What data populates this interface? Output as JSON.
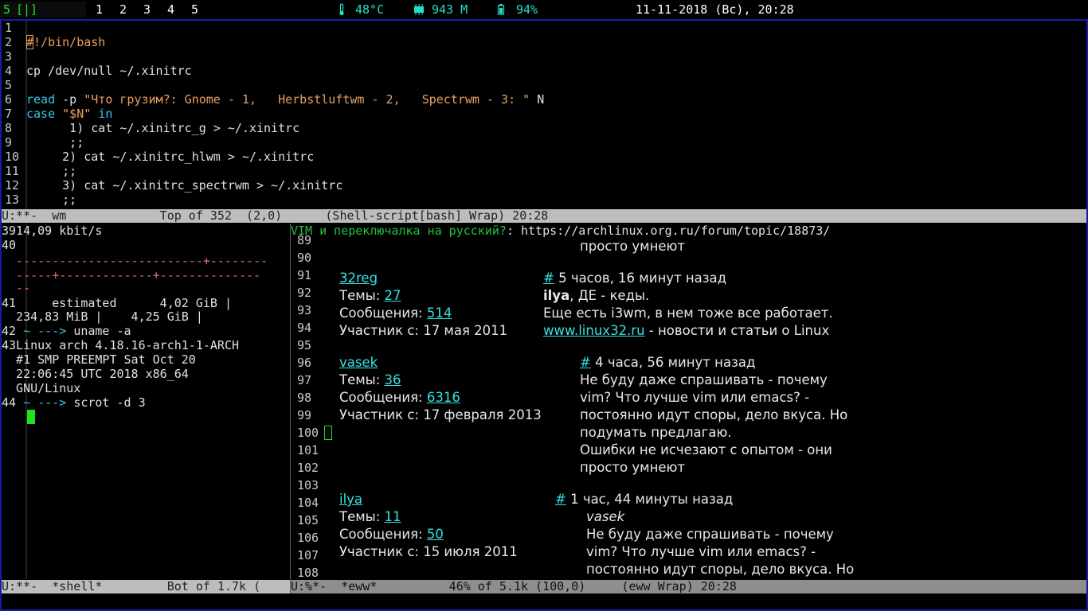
{
  "topbar": {
    "current_ws": "5",
    "layout": "[|]",
    "workspaces": [
      "1",
      "2",
      "3",
      "4",
      "5"
    ],
    "temp": "48°C",
    "mem": "943 M",
    "battery": "94%",
    "clock": "11-11-2018 (Вс), 20:28",
    "icons": [
      "thermometer-icon",
      "memory-icon",
      "battery-icon"
    ]
  },
  "editor": {
    "lines": [
      {
        "n": "1",
        "parts": []
      },
      {
        "n": "2",
        "parts": [
          {
            "c": "cmt",
            "t": "#!/bin/bash"
          }
        ]
      },
      {
        "n": "3",
        "parts": []
      },
      {
        "n": "4",
        "parts": [
          {
            "c": "txt",
            "t": "cp /dev/null ~/.xinitrc"
          }
        ]
      },
      {
        "n": "5",
        "parts": []
      },
      {
        "n": "6",
        "parts": [
          {
            "c": "kw",
            "t": "read"
          },
          {
            "c": "txt",
            "t": " -p "
          },
          {
            "c": "str",
            "t": "\"Что грузим?: Gnome - 1,   Herbstluftwm - 2,   Spectrwm - 3: \""
          },
          {
            "c": "txt",
            "t": " N"
          }
        ]
      },
      {
        "n": "7",
        "parts": [
          {
            "c": "kw",
            "t": "case"
          },
          {
            "c": "txt",
            "t": " "
          },
          {
            "c": "str",
            "t": "\"$N\""
          },
          {
            "c": "txt",
            "t": " "
          },
          {
            "c": "kw",
            "t": "in"
          }
        ]
      },
      {
        "n": "8",
        "parts": [
          {
            "c": "txt",
            "t": "      1) cat ~/.xinitrc_g > ~/.xinitrc"
          }
        ]
      },
      {
        "n": "9",
        "parts": [
          {
            "c": "txt",
            "t": "      ;;"
          }
        ]
      },
      {
        "n": "10",
        "parts": [
          {
            "c": "txt",
            "t": "     2) cat ~/.xinitrc_hlwm > ~/.xinitrc"
          }
        ]
      },
      {
        "n": "11",
        "parts": [
          {
            "c": "txt",
            "t": "     ;;"
          }
        ]
      },
      {
        "n": "12",
        "parts": [
          {
            "c": "txt",
            "t": "     3) cat ~/.xinitrc_spectrwm > ~/.xinitrc"
          }
        ]
      },
      {
        "n": "13",
        "parts": [
          {
            "c": "txt",
            "t": "     ;;"
          }
        ]
      }
    ],
    "modeline": "U:**-  wm             Top of 352  (2,0)      (Shell-script[bash] Wrap) 20:28"
  },
  "shell": {
    "lines": [
      {
        "t": "3914,09 kbit/s",
        "c": "txt"
      },
      {
        "t": "40",
        "c": "txt"
      },
      {
        "t": "  --------------------------+--------",
        "c": "dashes"
      },
      {
        "t": "  -----+-------------+--------------",
        "c": "dashes"
      },
      {
        "t": "  --",
        "c": "dashes"
      },
      {
        "t": "41     estimated      4,02 GiB |",
        "c": "txt"
      },
      {
        "t": "  234,83 MiB |    4,25 GiB |",
        "c": "txt"
      },
      {
        "t": "42",
        "c": "txt",
        "prompt": " ~ ---> ",
        "cmd": "uname -a"
      },
      {
        "t": "43Linux arch 4.18.16-arch1-1-ARCH",
        "c": "txt"
      },
      {
        "t": "  #1 SMP PREEMPT Sat Oct 20",
        "c": "txt"
      },
      {
        "t": "  22:06:45 UTC 2018 x86_64",
        "c": "txt"
      },
      {
        "t": "  GNU/Linux",
        "c": "txt"
      },
      {
        "t": "44",
        "c": "txt",
        "prompt": " ~ ---> ",
        "cmd": "scrot -d 3"
      }
    ],
    "modeline": "U:**-  *shell*         Bot of 1.7k ("
  },
  "eww": {
    "header_title": "VIM и переключалка на русский?",
    "header_url": ": https://archlinux.org.ru/forum/topic/18873/",
    "line_numbers": [
      "89",
      "90",
      "91",
      "92",
      "93",
      "94",
      "95",
      "96",
      "97",
      "98",
      "99",
      "100",
      "101",
      "102",
      "103",
      "104",
      "105",
      "106",
      "107",
      "108"
    ],
    "modeline": "U:%*-  *eww*          46% of 5.1k (100,0)     (eww Wrap) 20:28",
    "posts": {
      "p0_tail": "просто умнеют",
      "p1": {
        "user": "32reg",
        "topics_label": "Темы: ",
        "topics": "27",
        "msgs_label": "Сообщения: ",
        "msgs": "514",
        "since": "Участник с: 17 мая 2011",
        "hash": "#",
        "time": " 5 часов, 16 минут назад",
        "author": "ilya",
        "l2": ", ДЕ - кеды.",
        "l3": "Еще есть i3wm, в нем тоже все работает.",
        "link": "www.linux32.ru",
        "l4": " - новости и статьи о Linux"
      },
      "p2": {
        "user": "vasek",
        "topics_label": "Темы: ",
        "topics": "36",
        "msgs_label": "Сообщения: ",
        "msgs": "6316",
        "since": "Участник с: 17 февраля 2013",
        "hash": "#",
        "time": " 4 часа, 56 минут назад",
        "b1": "Не буду даже спрашивать - почему",
        "b2": "vim? Что лучше vim или emacs? -",
        "b3": "постоянно идут споры, дело вкуса. Но",
        "b4": "подумать предлагаю.",
        "b5": "Ошибки не исчезают с опытом - они",
        "b6": "просто умнеют"
      },
      "p3": {
        "user": "ilya",
        "topics_label": "Темы: ",
        "topics": "11",
        "msgs_label": "Сообщения: ",
        "msgs": "50",
        "since": "Участник с: 15 июля 2011",
        "hash": "#",
        "time": " 1 час, 44 минуты назад",
        "quote": "vasek",
        "b1": "Не буду даже спрашивать - почему",
        "b2": "vim? Что лучше vim или emacs? -",
        "b3": "постоянно идут споры, дело вкуса. Но"
      }
    }
  }
}
